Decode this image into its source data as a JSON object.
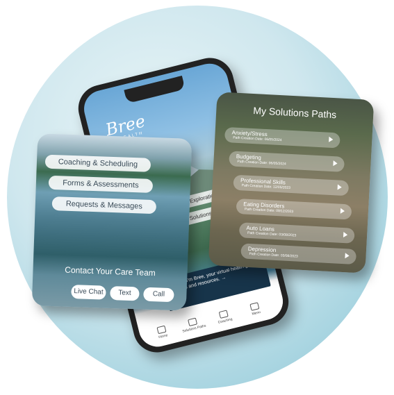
{
  "phone": {
    "logo": "Bree",
    "logo_sub": "HEALTH",
    "options": [
      {
        "label": "Start Exploration"
      },
      {
        "label": "My Solutions Path"
      }
    ],
    "chat_text": "Hi Lina, I'm Bree, your virtual health guide for tools and resources. →",
    "tabs": [
      {
        "label": "Home"
      },
      {
        "label": "Solutions Paths"
      },
      {
        "label": "Coaching"
      },
      {
        "label": "Menu"
      }
    ]
  },
  "left_card": {
    "menu": [
      {
        "label": "Coaching & Scheduling"
      },
      {
        "label": "Forms & Assessments"
      },
      {
        "label": "Requests & Messages"
      }
    ],
    "contact_title": "Contact Your Care Team",
    "buttons": [
      {
        "label": "Live Chat"
      },
      {
        "label": "Text"
      },
      {
        "label": "Call"
      }
    ]
  },
  "right_card": {
    "title": "My Solutions Paths",
    "paths": [
      {
        "name": "Anxiety/Stress",
        "date": "Path Creation Date: 06/05/2024"
      },
      {
        "name": "Budgeting",
        "date": "Path Creation Date: 06/05/2024"
      },
      {
        "name": "Professional Skills",
        "date": "Path Creation Date: 12/05/2023"
      },
      {
        "name": "Eating Disorders",
        "date": "Path Creation Date: 09/12/2023"
      },
      {
        "name": "Auto Loans",
        "date": "Path Creation Date: 03/08/2023"
      },
      {
        "name": "Depression",
        "date": "Path Creation Date: 03/08/2023"
      }
    ]
  }
}
